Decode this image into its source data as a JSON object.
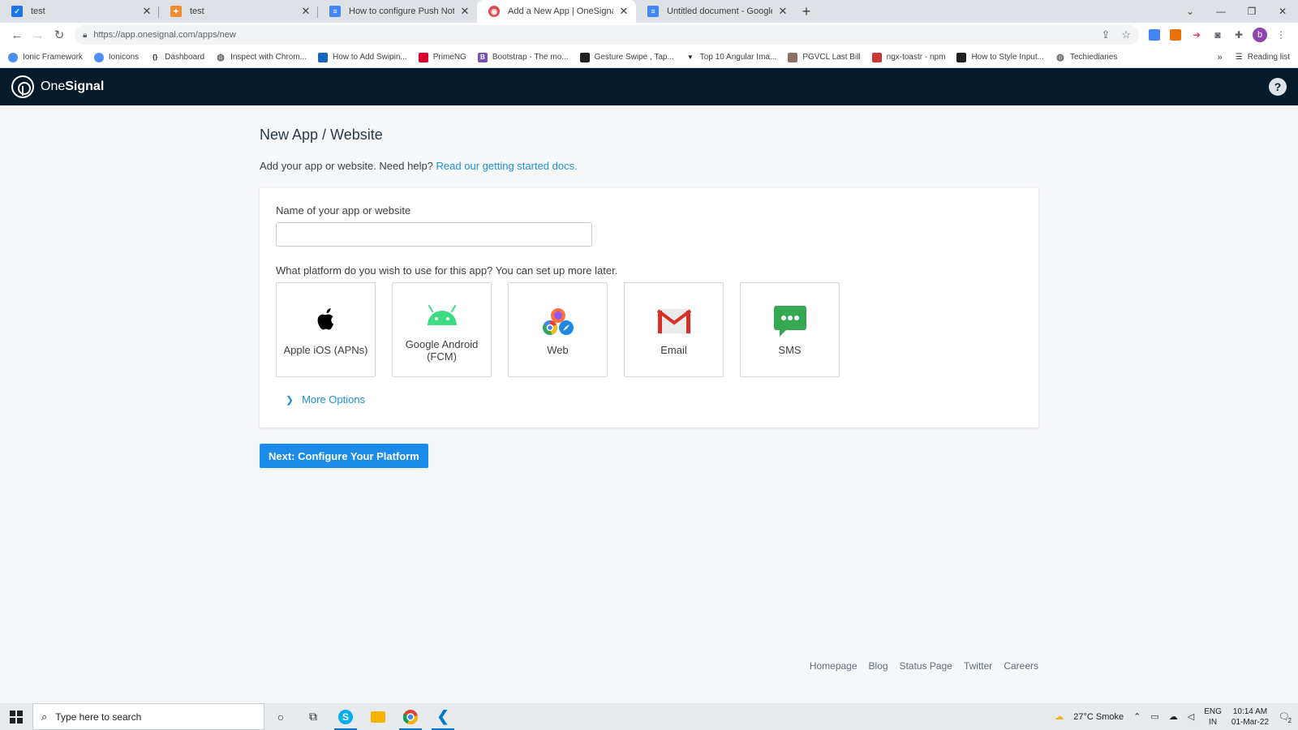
{
  "browser": {
    "tabs": [
      {
        "title": "test",
        "icon": "blue-doc-icon",
        "color": "#1a73e8"
      },
      {
        "title": "test",
        "icon": "orange-app-icon",
        "color": "#f28b30"
      },
      {
        "title": "How to configure Push Notificati",
        "icon": "google-docs-icon",
        "color": "#4285f4"
      },
      {
        "title": "Add a New App | OneSignal",
        "icon": "onesignal-icon",
        "color": "#e54b4d"
      },
      {
        "title": "Untitled document - Google Doc",
        "icon": "google-docs-icon",
        "color": "#4285f4"
      }
    ],
    "active_tab_index": 3,
    "url": "https://app.onesignal.com/apps/new",
    "profile_initial": "b",
    "bookmarks": [
      {
        "label": "Ionic Framework",
        "color": "#4e8ef7"
      },
      {
        "label": "Ionicons",
        "color": "#4e8ef7"
      },
      {
        "label": "Dashboard",
        "color": "#202124"
      },
      {
        "label": "Inspect with Chrom...",
        "color": "#5f6368"
      },
      {
        "label": "How to Add Swipin...",
        "color": "#1565c0"
      },
      {
        "label": "PrimeNG",
        "color": "#dd0031"
      },
      {
        "label": "Bootstrap - The mo...",
        "color": "#7952b3"
      },
      {
        "label": "Gesture Swipe , Tap...",
        "color": "#202124"
      },
      {
        "label": "Top 10 Angular Ima...",
        "color": "#202124"
      },
      {
        "label": "PGVCL Last Bill",
        "color": "#8d6e63"
      },
      {
        "label": "ngx-toastr - npm",
        "color": "#cb3837"
      },
      {
        "label": "How to Style Input...",
        "color": "#202124"
      },
      {
        "label": "Techiediaries",
        "color": "#5f6368"
      }
    ],
    "reading_list": "Reading list"
  },
  "app": {
    "brand": "OneSignal",
    "brand_parts": [
      "One",
      "Signal"
    ],
    "help_label": "?",
    "colors": {
      "header_bg": "#051b2c",
      "accent": "#1a8be8",
      "link": "#1f8fd8"
    }
  },
  "page": {
    "title": "New App / Website",
    "subtitle_text": "Add your app or website. Need help?",
    "subtitle_link": "Read our getting started docs.",
    "name_label": "Name of your app or website",
    "name_value": "",
    "name_placeholder": "",
    "platform_question": "What platform do you wish to use for this app? You can set up more later.",
    "platforms": [
      {
        "label": "Apple iOS (APNs)",
        "icon": "apple-icon"
      },
      {
        "label": "Google Android (FCM)",
        "icon": "android-icon"
      },
      {
        "label": "Web",
        "icon": "web-browsers-icon"
      },
      {
        "label": "Email",
        "icon": "gmail-icon"
      },
      {
        "label": "SMS",
        "icon": "sms-icon"
      }
    ],
    "more_options": "More Options",
    "next_button": "Next: Configure Your Platform"
  },
  "footer": {
    "links": [
      "Homepage",
      "Blog",
      "Status Page",
      "Twitter",
      "Careers"
    ]
  },
  "taskbar": {
    "search_placeholder": "Type here to search",
    "weather": "27°C  Smoke",
    "lang_top": "ENG",
    "lang_bottom": "IN",
    "time": "10:14 AM",
    "date": "01-Mar-22",
    "notification_count": "2"
  }
}
